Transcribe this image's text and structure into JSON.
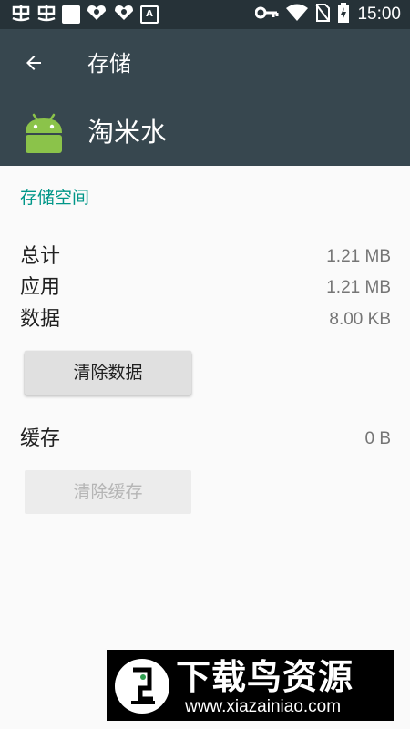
{
  "status_bar": {
    "left_icons": [
      "notification-bug-icon",
      "notification-bug-icon",
      "white-square-icon",
      "heart-badge-icon",
      "heart-badge-icon",
      "a-box-icon"
    ],
    "a_box_glyph": "A",
    "right_icons": [
      "key-icon",
      "wifi-icon",
      "no-sim-icon",
      "battery-charging-icon"
    ],
    "time": "15:00"
  },
  "toolbar": {
    "title": "存储"
  },
  "app": {
    "name": "淘米水",
    "icon": "android-robot-icon"
  },
  "storage": {
    "section_title": "存储空间",
    "total_label": "总计",
    "total_value": "1.21 MB",
    "app_label": "应用",
    "app_value": "1.21 MB",
    "data_label": "数据",
    "data_value": "8.00 KB",
    "clear_data_button": "清除数据",
    "cache_label": "缓存",
    "cache_value": "0 B",
    "clear_cache_button": "清除缓存"
  },
  "watermark": {
    "title": "下载鸟资源",
    "url": "www.xiazainiao.com"
  },
  "colors": {
    "status_bar": "#263238",
    "toolbar": "#37474f",
    "accent": "#009688",
    "background": "#fafafa",
    "android_green": "#8bc34a"
  }
}
